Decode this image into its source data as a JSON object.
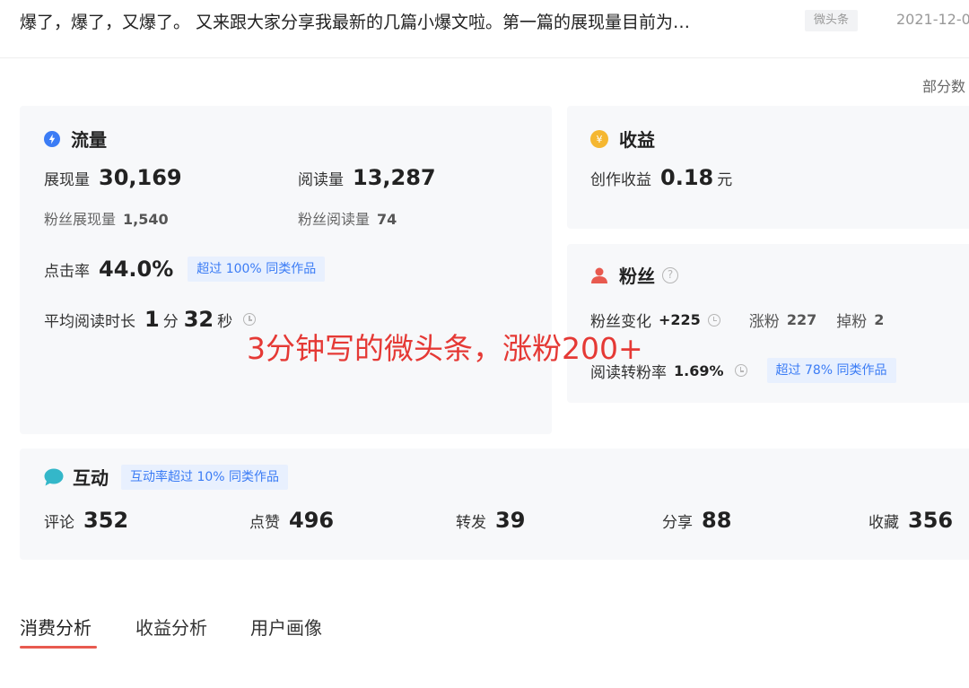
{
  "header": {
    "title": "爆了，爆了，又爆了。  又来跟大家分享我最新的几篇小爆文啦。第一篇的展现量目前为…",
    "tag": "微头条",
    "date": "2021-12-0",
    "partial_note": "部分数"
  },
  "traffic": {
    "title": "流量",
    "impressions_label": "展现量",
    "impressions_value": "30,169",
    "reads_label": "阅读量",
    "reads_value": "13,287",
    "fan_impressions_label": "粉丝展现量",
    "fan_impressions_value": "1,540",
    "fan_reads_label": "粉丝阅读量",
    "fan_reads_value": "74",
    "ctr_label": "点击率",
    "ctr_value": "44.0%",
    "ctr_badge": "超过 100% 同类作品",
    "avg_read_label": "平均阅读时长",
    "avg_read_min": "1",
    "avg_read_min_unit": "分",
    "avg_read_sec": "32",
    "avg_read_sec_unit": "秒"
  },
  "income": {
    "title": "收益",
    "creation_label": "创作收益",
    "creation_value": "0.18",
    "creation_unit": "元"
  },
  "fans": {
    "title": "粉丝",
    "change_label": "粉丝变化",
    "change_value": "+225",
    "gain_label": "涨粉",
    "gain_value": "227",
    "loss_label": "掉粉",
    "loss_value": "2",
    "conversion_label": "阅读转粉率",
    "conversion_value": "1.69%",
    "conversion_badge": "超过 78% 同类作品"
  },
  "interaction": {
    "title": "互动",
    "badge": "互动率超过 10% 同类作品",
    "comments_label": "评论",
    "comments_value": "352",
    "likes_label": "点赞",
    "likes_value": "496",
    "reposts_label": "转发",
    "reposts_value": "39",
    "shares_label": "分享",
    "shares_value": "88",
    "favorites_label": "收藏",
    "favorites_value": "356"
  },
  "overlay_caption": "3分钟写的微头条，涨粉200+",
  "tabs": [
    {
      "label": "消费分析",
      "active": true
    },
    {
      "label": "收益分析",
      "active": false
    },
    {
      "label": "用户画像",
      "active": false
    }
  ],
  "colors": {
    "traffic_icon": "#3b7cf5",
    "income_icon": "#f5b731",
    "fans_icon": "#e85a4f",
    "interaction_icon": "#34b7c9",
    "badge_text": "#3b7cf5",
    "overlay_text": "#e53935",
    "tab_underline": "#e85a4f"
  }
}
